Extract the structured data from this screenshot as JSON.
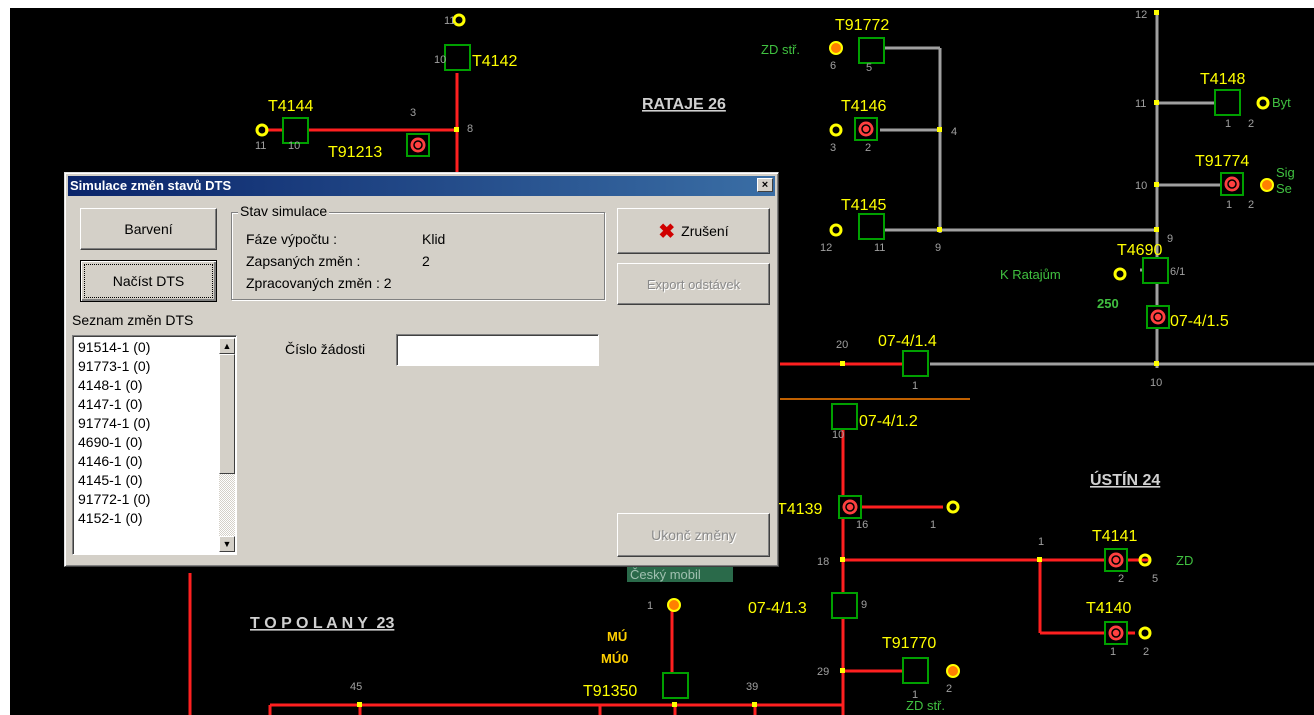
{
  "map": {
    "nodes": {
      "t4142": "T4142",
      "t4144": "T4144",
      "t91213": "T91213",
      "t91772": "T91772",
      "t4146": "T4146",
      "t4145": "T4145",
      "t4148": "T4148",
      "t91774": "T91774",
      "t4690": "T4690",
      "t4139": "T4139",
      "t4141": "T4141",
      "t4140": "T4140",
      "t91770": "T91770",
      "t91350": "T91350",
      "s07_4_1_4": "07-4/1.4",
      "s07_4_1_5": "07-4/1.5",
      "s07_4_1_2": "07-4/1.2",
      "s07_4_1_3": "07-4/1.3"
    },
    "areas": {
      "rataje": "RATAJE 26",
      "ustin": "ÚSTÍN 24",
      "topolany": "T O P O L A N Y  23"
    },
    "labels": {
      "zd_str_top": "ZD stř.",
      "zd_str_bottom": "ZD stř.",
      "byt": "Byt",
      "sig": "Sig",
      "se": "Se",
      "k_ratajum": "K Ratajům",
      "val_250": "250",
      "zd": "ZD",
      "mu": "MÚ",
      "mu0": "MÚ0",
      "cesky_mobil": "Český mobil"
    },
    "numbers": {
      "n11a": "11",
      "n10a": "10",
      "n3": "3",
      "n8": "8",
      "n11b": "11",
      "n10b": "10",
      "n6": "6",
      "n5": "5",
      "n3b": "3",
      "n2a": "2",
      "n4": "4",
      "n12a": "12",
      "n11c": "11",
      "n9a": "9",
      "n12b": "12",
      "n11d": "11",
      "n1a": "1",
      "n2b": "2",
      "n10c": "10",
      "n1b": "1",
      "n2c": "2",
      "n9b": "9",
      "n6_1": "6/1",
      "n20": "20",
      "n1c": "1",
      "n10d": "10",
      "n16": "16",
      "n1d": "1",
      "n1e": "1",
      "n2d": "2",
      "n5b": "5",
      "n18": "18",
      "n1f": "1",
      "n2e": "2",
      "n9c": "9",
      "n1g": "1",
      "n29": "29",
      "n2f": "2",
      "n45": "45",
      "n39": "39",
      "n1h": "1",
      "n10e": "10"
    }
  },
  "dialog": {
    "title": "Simulace změn stavů DTS",
    "close": "×",
    "btn_barveni": "Barvení",
    "btn_nacist": "Načíst DTS",
    "btn_zruseni": "Zrušení",
    "btn_export": "Export odstávek",
    "btn_ukonc": "Ukonč změny",
    "group_title": "Stav simulace",
    "faze_label": "Fáze výpočtu :",
    "faze_value": "Klid",
    "zapsanych_label": "Zapsaných změn :",
    "zapsanych_value": "2",
    "zpracovanych_label": "Zpracovaných změn : 2",
    "seznam_label": "Seznam změn DTS",
    "cislo_label": "Číslo žádosti",
    "cislo_value": "",
    "list_items": [
      "91514-1 (0)",
      "91773-1 (0)",
      "4148-1 (0)",
      "4147-1 (0)",
      "91774-1 (0)",
      "4690-1 (0)",
      "4146-1 (0)",
      "4145-1 (0)",
      "91772-1 (0)",
      "4152-1 (0)"
    ]
  },
  "colors": {
    "red": "#ff2020",
    "gray": "#a0a0a0",
    "yellow": "#ffff00",
    "green": "#40c040",
    "box": "#00a000",
    "orange": "#ff8000",
    "brown": "#c06000"
  }
}
